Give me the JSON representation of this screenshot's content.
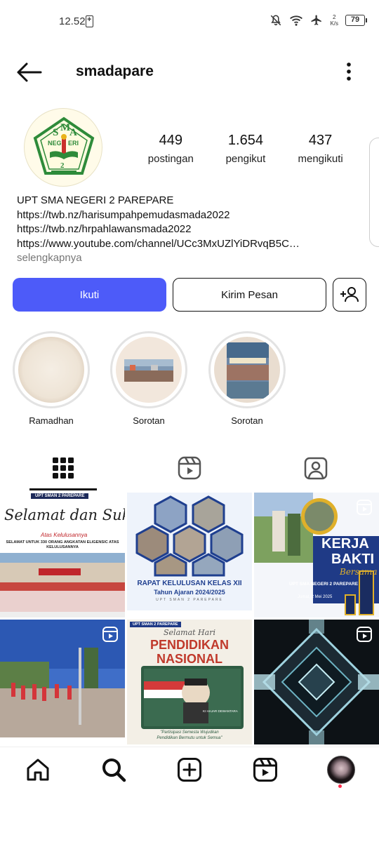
{
  "status": {
    "time": "12.52",
    "net_speed_top": "2",
    "net_speed_unit": "K/s",
    "battery": "79"
  },
  "header": {
    "username": "smadapare"
  },
  "avatar": {
    "logo_text": "SMA NEGERI 2 PAREPARE"
  },
  "stats": [
    {
      "value": "449",
      "label": "postingan"
    },
    {
      "value": "1.654",
      "label": "pengikut"
    },
    {
      "value": "437",
      "label": "mengikuti"
    }
  ],
  "bio": {
    "name": "UPT SMA NEGERI 2 PAREPARE",
    "line1": "https://twb.nz/harisumpahpemudasmada2022",
    "line2": "https://twb.nz/hrpahlawansmada2022",
    "line3": "https://www.youtube.com/channel/UCc3MxUZlYiDRvqB5C…",
    "more": "selengkapnya"
  },
  "buttons": {
    "follow": "Ikuti",
    "message": "Kirim Pesan"
  },
  "highlights": [
    {
      "label": "Ramadhan"
    },
    {
      "label": "Sorotan"
    },
    {
      "label": "Sorotan"
    }
  ],
  "posts": {
    "p1": {
      "school": "UPT SMAN 2 PAREPARE",
      "title": "Selamat dan Sukses",
      "subtitle": "Atas Kelulusannya",
      "caption": "SELAMAT UNTUK 330 ORANG ANGKATAN ELIGENSIC ATAS KELULUSANNYA"
    },
    "p2": {
      "title": "RAPAT KELULUSAN KELAS XII",
      "subtitle": "Tahun Ajaran 2024/2025",
      "school": "UPT SMAN 2 PAREPARE"
    },
    "p3": {
      "title1": "KERJA",
      "title2": "BAKTI",
      "script": "Bersama",
      "school": "UPT SMA NEGERI 2 PAREPARE",
      "date": "Jumat, 2 Mei 2025"
    },
    "p5": {
      "school": "UPT SMAN 2 PAREPARE",
      "script": "Selamat Hari",
      "title1": "PENDIDIKAN",
      "title2": "NASIONAL",
      "name": "KI HAJAR DEWANTARA",
      "quote1": "\"Partisipasi Semesta Wujudkan",
      "quote2": "Pendidikan Bermutu untuk Semua\""
    }
  }
}
